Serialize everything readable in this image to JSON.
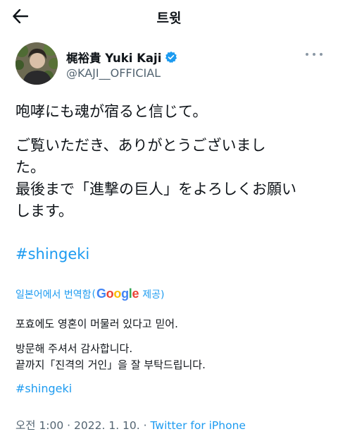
{
  "header": {
    "title": "트윗"
  },
  "author": {
    "display_name": "梶裕貴 Yuki Kaji",
    "handle": "@KAJI__OFFICIAL",
    "verified": true
  },
  "tweet": {
    "lines": [
      "咆哮にも魂が宿ると信じて。",
      "ご覧いただき、ありがとうございまし",
      "た。",
      "最後まで「進撃の巨人」をよろしくお願い",
      "します。"
    ],
    "hashtag": "#shingeki"
  },
  "translation": {
    "translated_from": "일본어에서 번역함",
    "by": "Google",
    "provided": "제공)",
    "lines": [
      "포효에도 영혼이 머물러 있다고 믿어.",
      "방문해 주셔서 감사합니다.",
      "끝까지「진격의 거인」을 잘 부탁드립니다."
    ],
    "hashtag": "#shingeki"
  },
  "meta": {
    "time": "오전 1:00 · 2022. 1. 10. ·",
    "source": "Twitter for iPhone"
  },
  "colors": {
    "accent": "#1d9bf0",
    "secondary_text": "#536471",
    "verified": "#1d9bf0"
  }
}
